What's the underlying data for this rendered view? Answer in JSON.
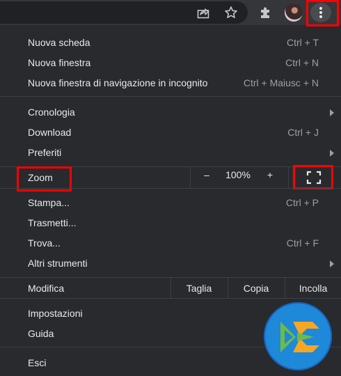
{
  "toolbar": {
    "share_icon": "share-icon",
    "bookmark_icon": "star-icon",
    "extensions_icon": "puzzle-icon",
    "avatar": "profile-avatar",
    "menu_icon": "three-dots-vertical-icon"
  },
  "menu": {
    "group1": [
      {
        "label": "Nuova scheda",
        "shortcut": "Ctrl + T"
      },
      {
        "label": "Nuova finestra",
        "shortcut": "Ctrl + N"
      },
      {
        "label": "Nuova finestra di navigazione in incognito",
        "shortcut": "Ctrl + Maiusc + N"
      }
    ],
    "group2": [
      {
        "label": "Cronologia",
        "submenu": true
      },
      {
        "label": "Download",
        "shortcut": "Ctrl + J"
      },
      {
        "label": "Preferiti",
        "submenu": true
      }
    ],
    "zoom": {
      "label": "Zoom",
      "minus": "–",
      "value": "100%",
      "plus": "+",
      "fullscreen_icon": "fullscreen-icon"
    },
    "group3": [
      {
        "label": "Stampa...",
        "shortcut": "Ctrl + P"
      },
      {
        "label": "Trasmetti..."
      },
      {
        "label": "Trova...",
        "shortcut": "Ctrl + F"
      },
      {
        "label": "Altri strumenti",
        "submenu": true
      }
    ],
    "edit": {
      "label": "Modifica",
      "cut": "Taglia",
      "copy": "Copia",
      "paste": "Incolla"
    },
    "group4": [
      {
        "label": "Impostazioni"
      },
      {
        "label": "Guida",
        "submenu": true
      }
    ],
    "exit": {
      "label": "Esci"
    }
  },
  "colors": {
    "background": "#292a2d",
    "toolbar": "#35363a",
    "text": "#e8eaed",
    "shortcut_text": "#9aa0a6",
    "highlight_box": "#ff0000",
    "logo_circle": "#1e88d9"
  },
  "overlay_logo": "channel-logo-icon"
}
